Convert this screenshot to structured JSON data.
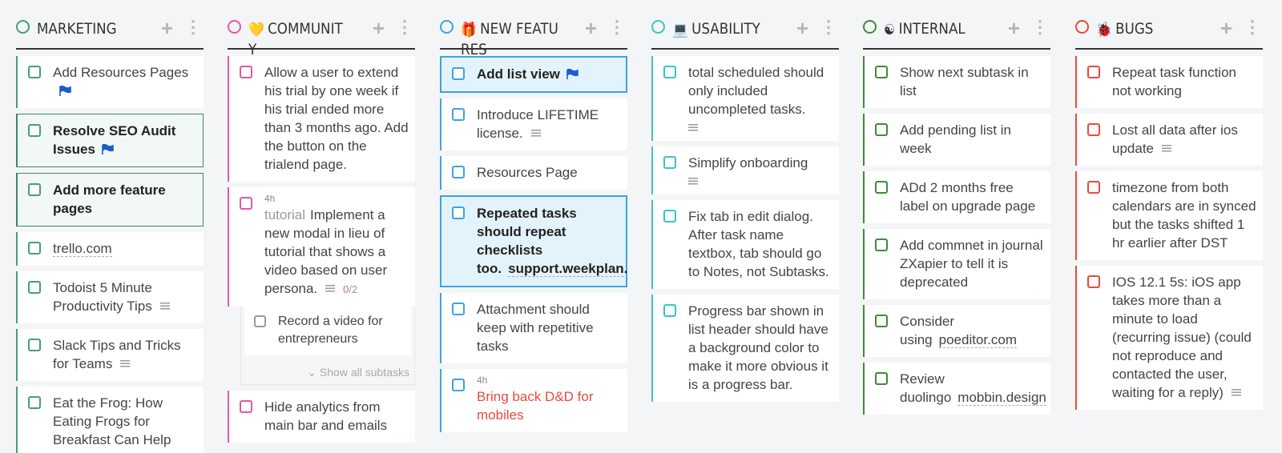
{
  "colors": {
    "marketing": "#4a9c7a",
    "community": "#e05aa8",
    "new_feature": "#3ba3e5",
    "usability": "#3cc2c8",
    "internal": "#3e8a3a",
    "bugs": "#e84b3c",
    "flag": "#1a5fd0",
    "link_red": "#e84b3c"
  },
  "columns": [
    {
      "key": "marketing",
      "title": "MARKETING",
      "emoji": "",
      "cards": [
        {
          "text": "Add Resources Pages",
          "flag": true
        },
        {
          "text": "Resolve SEO Audit Issues",
          "flag": true,
          "bold": true,
          "highlight": true
        },
        {
          "text": "Add more feature pages",
          "bold": true,
          "highlight": true
        },
        {
          "link": "trello.com"
        },
        {
          "text": "Todoist 5 Minute Productivity Tips",
          "note": true
        },
        {
          "text": "Slack Tips and Tricks for Teams",
          "note": true
        },
        {
          "text": "Eat the Frog: How Eating Frogs for Breakfast Can Help"
        }
      ]
    },
    {
      "key": "community",
      "title": "COMMUNITY",
      "emoji": "💛",
      "cards": [
        {
          "text": "Allow a user to extend his trial by one week if his trial ended more than 3 months ago. Add the button on the trialend page."
        },
        {
          "estimate": "4h",
          "tag": "tutorial",
          "text": "Implement a new modal in lieu of tutorial that shows a video based on user persona.",
          "note": true,
          "subtasks_done": "0",
          "subtasks_total": "/2",
          "subtasks": [
            "Record a video for entrepreneurs"
          ],
          "show_all": "⌄ Show all subtasks"
        },
        {
          "text": "Hide analytics from main bar and emails"
        }
      ]
    },
    {
      "key": "new_feature",
      "title": "NEW FEATURES",
      "emoji": "🎁",
      "cards": [
        {
          "text": "Add list view",
          "flag": true,
          "bold": true,
          "selected": true
        },
        {
          "text": "Introduce LIFETIME license.",
          "note": true
        },
        {
          "text": "Resources Page"
        },
        {
          "text": "Repeated tasks should repeat checklists too.",
          "link": "support.weekplan.net",
          "bold": true,
          "selected": true
        },
        {
          "text": "Attachment should keep with repetitive tasks"
        },
        {
          "estimate": "4h",
          "text": "Bring back D&D for mobiles",
          "red": true
        }
      ]
    },
    {
      "key": "usability",
      "title": "USABILITY",
      "emoji": "💻",
      "cards": [
        {
          "text": "total scheduled should only included uncompleted tasks.",
          "note_line": true
        },
        {
          "text": "Simplify onboarding",
          "note_line": true
        },
        {
          "text": "Fix tab in edit dialog. After task name textbox, tab should go to Notes, not Subtasks."
        },
        {
          "text": "Progress bar shown in list header should have a background color to make it more obvious it is a progress bar."
        }
      ]
    },
    {
      "key": "internal",
      "title": "INTERNAL",
      "emoji": "☯",
      "cards": [
        {
          "text": "Show next subtask in list"
        },
        {
          "text": "Add pending list in week"
        },
        {
          "text": "ADd 2 months free label on upgrade page"
        },
        {
          "text": "Add commnet in journal ZXapier to tell it is deprecated"
        },
        {
          "text": "Consider using",
          "link": "poeditor.com"
        },
        {
          "text": "Review duolingo",
          "link": "mobbin.design"
        }
      ]
    },
    {
      "key": "bugs",
      "title": "BUGS",
      "emoji": "🐞",
      "cards": [
        {
          "text": "Repeat task function not working"
        },
        {
          "text": "Lost all data after ios update",
          "note": true
        },
        {
          "text": "timezone from both calendars are in synced but the tasks shifted 1 hr earlier after DST"
        },
        {
          "text": "IOS 12.1 5s: iOS app takes more than a minute to load (recurring issue) (could not reproduce and contacted the user, waiting for a reply)",
          "note": true
        }
      ]
    }
  ]
}
